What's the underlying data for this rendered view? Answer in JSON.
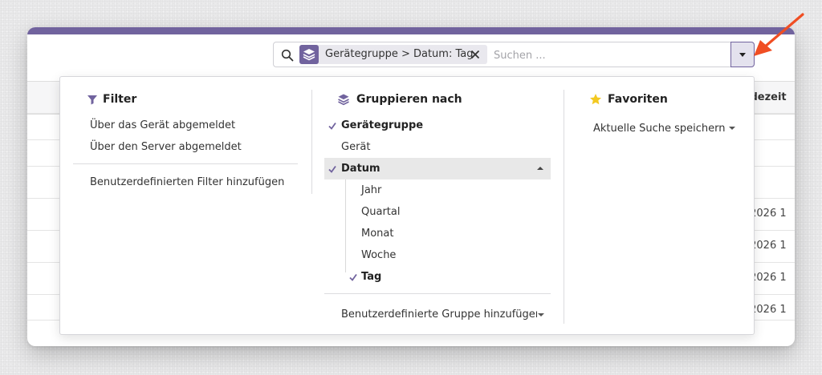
{
  "background_table": {
    "column_header": "ldezeit",
    "cells": [
      ".2026 1",
      ".2026 1",
      ".2026 1",
      ".2026 1"
    ]
  },
  "search": {
    "facet_label": "Gerätegruppe > Datum: Tag",
    "placeholder": "Suchen ..."
  },
  "dropdown": {
    "filter": {
      "title": "Filter",
      "items": [
        "Über das Gerät abgemeldet",
        "Über den Server abgemeldet"
      ],
      "custom": "Benutzerdefinierten Filter hinzufügen"
    },
    "groupby": {
      "title": "Gruppieren nach",
      "items": [
        "Gerätegruppe",
        "Gerät",
        "Datum"
      ],
      "date_options": [
        "Jahr",
        "Quartal",
        "Monat",
        "Woche",
        "Tag"
      ],
      "custom": "Benutzerdefinierte Gruppe hinzufügen"
    },
    "favorites": {
      "title": "Favoriten",
      "save": "Aktuelle Suche speichern"
    }
  },
  "colors": {
    "brand": "#71639e",
    "annotation_arrow": "#f04e23",
    "star": "#f3c921"
  },
  "icons": {
    "search": "search-icon",
    "facet": "layers-icon",
    "remove": "close-icon",
    "toggle": "caret-down-icon",
    "filter": "funnel-icon",
    "groupby": "layers-icon",
    "favorites": "star-icon",
    "check": "check-icon"
  }
}
